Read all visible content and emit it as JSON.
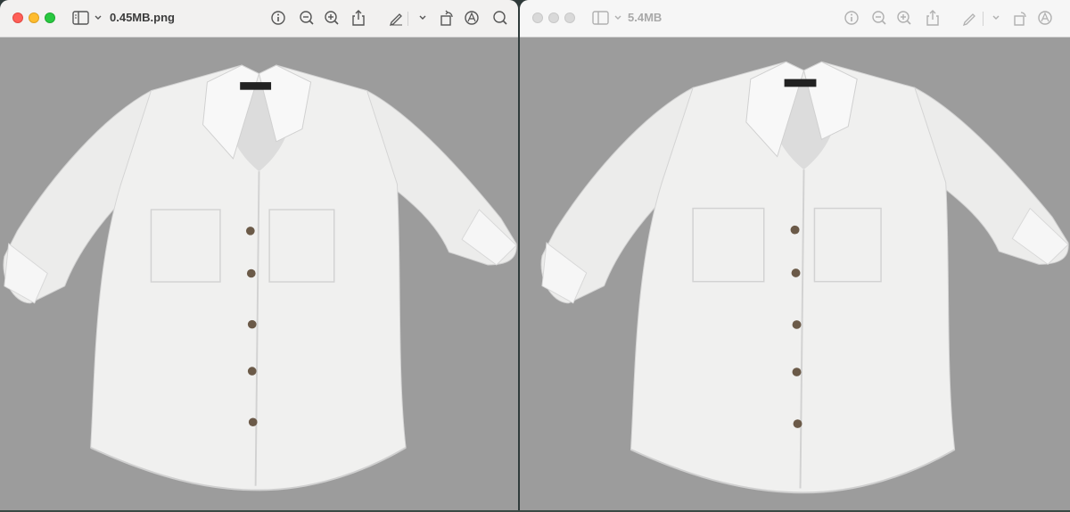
{
  "windows": [
    {
      "title": "0.45MB.png",
      "active": true,
      "image": "white button-up shirt photo"
    },
    {
      "title": "5.4MB",
      "active": false,
      "image": "white button-up shirt photo"
    }
  ],
  "toolbar_icons": [
    "sidebar-toggle-icon",
    "chevron-down-icon",
    "info-icon",
    "zoom-out-icon",
    "zoom-in-icon",
    "share-icon",
    "markup-pen-icon",
    "rotate-icon",
    "markup-circle-icon",
    "search-icon"
  ],
  "colors": {
    "close": "#ff5f57",
    "minimize": "#febc2e",
    "zoom": "#28c840",
    "inactive_light": "#d9d9d9",
    "canvas_gray": "#9c9c9c",
    "titlebar": "#f2f1f0"
  }
}
